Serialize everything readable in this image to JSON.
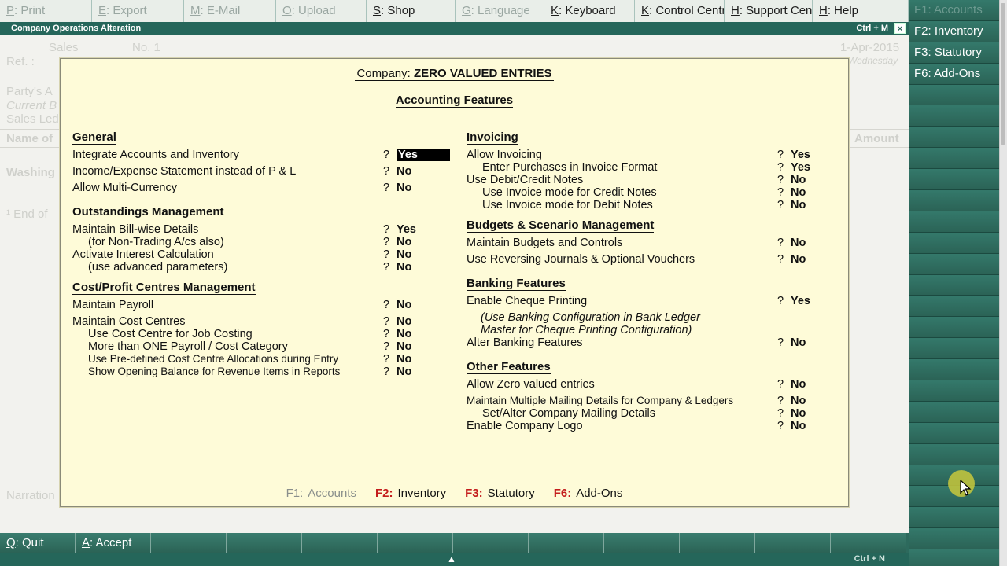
{
  "topbar": [
    {
      "key": "P",
      "label": ": Print",
      "active": false,
      "width": 117
    },
    {
      "key": "E",
      "label": ": Export",
      "active": false,
      "width": 117
    },
    {
      "key": "M",
      "label": ": E-Mail",
      "active": false,
      "width": 117
    },
    {
      "key": "O",
      "label": ": Upload",
      "active": false,
      "width": 115
    },
    {
      "key": "S",
      "label": ": Shop",
      "active": true,
      "width": 113
    },
    {
      "key": "G",
      "label": ": Language",
      "active": false,
      "width": 113
    },
    {
      "key": "K",
      "label": ": Keyboard",
      "active": true,
      "width": 115
    },
    {
      "key": "K",
      "label": ": Control Centre",
      "active": true,
      "width": 114
    },
    {
      "key": "H",
      "label": ": Support Centre",
      "active": true,
      "width": 112
    },
    {
      "key": "H",
      "label": ": Help",
      "active": true,
      "width": 122
    }
  ],
  "title_strip": {
    "title": "Company Operations  Alteration",
    "shortcut": "Ctrl + M",
    "close": "×"
  },
  "rightbar": [
    {
      "label": "F1: Accounts",
      "dim": true
    },
    {
      "label": "F2: Inventory",
      "dim": false
    },
    {
      "label": "F3: Statutory",
      "dim": false
    },
    {
      "label": "F6: Add-Ons",
      "dim": false
    }
  ],
  "background": {
    "voucher_type": "Sales",
    "no_label": "No. 1",
    "ref_label": "Ref. :",
    "date": "1-Apr-2015",
    "weekday": "Wednesday",
    "party_label": "Party's A",
    "current_label": "Current B",
    "sales_ledger": "Sales Led",
    "name_of": "Name of",
    "amount": "Amount",
    "item": "Washing",
    "end_of": "¹ End of",
    "narration": "Narration"
  },
  "dialog": {
    "company_label": "Company:",
    "company_name": "ZERO VALUED ENTRIES",
    "title": "Accounting Features",
    "left": [
      {
        "type": "head",
        "text": "General"
      },
      {
        "type": "row",
        "label": "Integrate Accounts and Inventory",
        "value": "Yes",
        "focus": true
      },
      {
        "type": "row",
        "label": "Income/Expense Statement instead of P & L",
        "value": "No"
      },
      {
        "type": "row",
        "label": "Allow Multi-Currency",
        "value": "No"
      },
      {
        "type": "head",
        "text": "Outstandings Management"
      },
      {
        "type": "row",
        "label": "Maintain Bill-wise Details",
        "value": "Yes"
      },
      {
        "type": "row",
        "label": "(for Non-Trading A/cs also)",
        "value": "No",
        "indent": true
      },
      {
        "type": "row",
        "label": "Activate Interest Calculation",
        "value": "No"
      },
      {
        "type": "row",
        "label": "(use advanced parameters)",
        "value": "No",
        "indent": true
      },
      {
        "type": "head",
        "text": "Cost/Profit Centres Management"
      },
      {
        "type": "row",
        "label": "Maintain Payroll",
        "value": "No"
      },
      {
        "type": "row",
        "label": "Maintain Cost Centres",
        "value": "No"
      },
      {
        "type": "row",
        "label": "Use Cost Centre for Job Costing",
        "value": "No",
        "indent": true
      },
      {
        "type": "row",
        "label": "More than ONE Payroll / Cost Category",
        "value": "No",
        "indent": true
      },
      {
        "type": "row",
        "label": "Use Pre-defined Cost Centre Allocations during Entry",
        "value": "No",
        "indent": true,
        "small": true
      },
      {
        "type": "row",
        "label": "Show Opening Balance for Revenue Items in Reports",
        "value": "No",
        "indent": true,
        "small": true
      }
    ],
    "right": [
      {
        "type": "head",
        "text": "Invoicing"
      },
      {
        "type": "row",
        "label": "Allow Invoicing",
        "value": "Yes"
      },
      {
        "type": "row",
        "label": "Enter Purchases in Invoice Format",
        "value": "Yes",
        "indent": true
      },
      {
        "type": "row",
        "label": "Use Debit/Credit Notes",
        "value": "No"
      },
      {
        "type": "row",
        "label": "Use Invoice mode for Credit Notes",
        "value": "No",
        "indent": true
      },
      {
        "type": "row",
        "label": "Use Invoice mode for Debit Notes",
        "value": "No",
        "indent": true
      },
      {
        "type": "head",
        "text": "Budgets & Scenario Management"
      },
      {
        "type": "row",
        "label": "Maintain Budgets and Controls",
        "value": "No"
      },
      {
        "type": "row",
        "label": "Use Reversing Journals & Optional Vouchers",
        "value": "No"
      },
      {
        "type": "head",
        "text": "Banking Features"
      },
      {
        "type": "row",
        "label": "Enable Cheque Printing",
        "value": "Yes"
      },
      {
        "type": "note",
        "text": "(Use Banking Configuration in Bank Ledger"
      },
      {
        "type": "note",
        "text": "Master for Cheque Printing Configuration)"
      },
      {
        "type": "row",
        "label": "Alter Banking Features",
        "value": "No"
      },
      {
        "type": "head",
        "text": "Other Features"
      },
      {
        "type": "row",
        "label": "Allow Zero valued entries",
        "value": "No"
      },
      {
        "type": "row",
        "label": "Maintain Multiple Mailing Details for Company & Ledgers",
        "value": "No",
        "small": true
      },
      {
        "type": "row",
        "label": "Set/Alter Company Mailing Details",
        "value": "No",
        "indent": true
      },
      {
        "type": "row",
        "label": "Enable Company Logo",
        "value": "No"
      }
    ],
    "footer": [
      {
        "key": "F1:",
        "label": "Accounts",
        "dim": true
      },
      {
        "key": "F2:",
        "label": "Inventory",
        "dim": false
      },
      {
        "key": "F3:",
        "label": "Statutory",
        "dim": false
      },
      {
        "key": "F6:",
        "label": "Add-Ons",
        "dim": false
      }
    ]
  },
  "bottombar": [
    {
      "key": "Q",
      "label": ": Quit"
    },
    {
      "key": "A",
      "label": ": Accept"
    },
    {
      "key": "",
      "label": ""
    },
    {
      "key": "",
      "label": ""
    },
    {
      "key": "",
      "label": ""
    },
    {
      "key": "",
      "label": ""
    },
    {
      "key": "",
      "label": ""
    },
    {
      "key": "",
      "label": ""
    },
    {
      "key": "",
      "label": ""
    },
    {
      "key": "",
      "label": ""
    },
    {
      "key": "",
      "label": ""
    },
    {
      "key": "",
      "label": ""
    }
  ],
  "status": {
    "up_arrow": "▲",
    "shortcut": "Ctrl + N"
  }
}
